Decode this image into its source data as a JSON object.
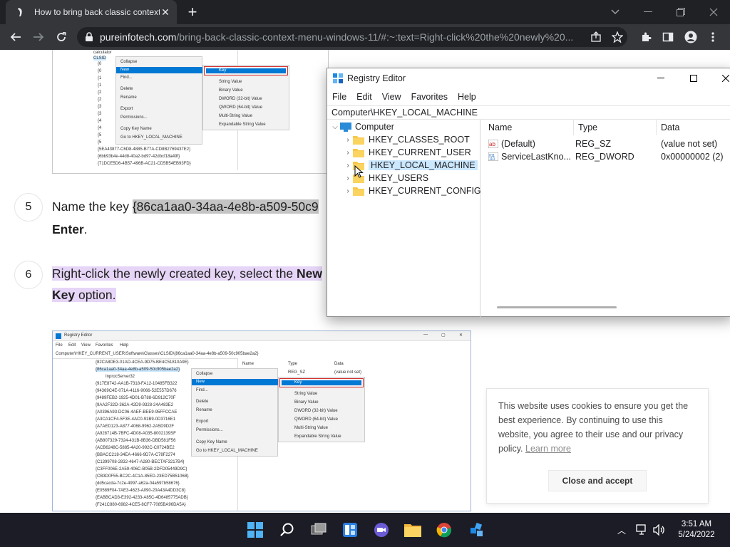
{
  "browser": {
    "tab_title": "How to bring back classic context menu",
    "url_host": "pureinfotech.com",
    "url_path": "/bring-back-classic-context-menu-windows-11/#:~:text=Right-click%20the%20newly%20..."
  },
  "screenshot1": {
    "tree": [
      "calculator",
      "CLSID",
      "{0",
      "{0",
      "{1",
      "{1",
      "{2",
      "{2",
      "{3",
      "{3",
      "{4",
      "{4",
      "{5",
      "{5",
      "{5EA43877-C6D8-4885-B77A-CD8B2769437E2}",
      "{6bb93b4e-44d8-40a2-bd97-42dbcf18a49f}",
      "{71DCE5D6-4B57-496B-AC21-CD5B54EB93FD}"
    ],
    "context_menu": [
      "Collapse",
      "New",
      "Find...",
      "Delete",
      "Rename",
      "Export",
      "Permissions...",
      "Copy Key Name",
      "Go to HKEY_LOCAL_MACHINE"
    ],
    "submenu": [
      "Key",
      "String Value",
      "Binary Value",
      "DWORD (32-bit) Value",
      "QWORD (64-bit) Value",
      "Multi-String Value",
      "Expandable String Value"
    ]
  },
  "steps": [
    {
      "num": "5",
      "pre": "Name the key ",
      "highlight": "{86ca1aa0-34aa-4e8b-a509-50c9",
      "line2_bold": "Enter",
      "line2_rest": "."
    },
    {
      "num": "6",
      "line1": "Right-click the newly created key, select the ",
      "line1_bold": "New",
      "line2_bold": "Key",
      "line2_rest": " option."
    }
  ],
  "screenshot2": {
    "title": "Registry Editor",
    "menu": [
      "File",
      "Edit",
      "View",
      "Favorites",
      "Help"
    ],
    "address": "Computer\\HKEY_CURRENT_USER\\Software\\Classes\\CLSID\\{86ca1aa0-34aa-4e8b-a509-50c905bae2a2}",
    "tree": [
      "{82CA8DE3-01AD-4CEA-9D75-BE4C51810A9E}",
      "{86ca1aa0-34aa-4e8b-a509-50c905bae2a2}",
      "InprocServer32",
      "{917E8742-AA1B-7318-FA12-10485FB322",
      "{94369C4E-071A-4116-9066-52E557D676",
      "{9489FEB2-1925-4D01-B788-6D912C70F",
      "{9AA2F32D-362A-42D9-9328-24A483E2",
      "{A0396A93-DC06-4AEF-BEE9-95FFCCAE",
      "{A3CA1CF4-5F3E-4AC0-91B9-0D3716E1",
      "{A7AED123-A877-4068-9962-2A5D9D2F",
      "{A928714B-7BFC-4D08-A035-8002139SF",
      "{AB807329-7324-431B-8B36-DBD581F56",
      "{ACB6248C-5885-4A20-992C-C0724BE2",
      "{BBACC218-34EA-4666-9D7A-C78F2274",
      "{C1399708-2832-4647-A280-BECTAF3217B4}",
      "{C3FF006E-2A59-406C-B05B-2DFD05449D9C}",
      "{CB3D0F55-BC2C-4C1A-85ED-23ED75B5106B}",
      "{dd5cacda-7c2e-4997-a62a-04a597b58676}",
      "{E0589F04-7AE3-4623-A090-20A43A4DD3C8}",
      "{EABBCAD3-E392-4233-A85C-4D6485775ADB}",
      "{F241C880-6982-4CE5-8CF7-7085BA96DA5A}"
    ],
    "list_headers": [
      "Name",
      "Type",
      "Data"
    ],
    "list_row": [
      "",
      "REG_SZ",
      "(value not set)"
    ],
    "context_menu": [
      "Collapse",
      "New",
      "Find...",
      "Delete",
      "Rename",
      "Export",
      "Permissions...",
      "Copy Key Name",
      "Go to HKEY_LOCAL_MACHINE"
    ],
    "submenu": [
      "Key",
      "String Value",
      "Binary Value",
      "DWORD (32-bit) Value",
      "QWORD (64-bit) Value",
      "Multi-String Value",
      "Expandable String Value"
    ]
  },
  "registry": {
    "title": "Registry Editor",
    "menu": [
      "File",
      "Edit",
      "View",
      "Favorites",
      "Help"
    ],
    "address": "Computer\\HKEY_LOCAL_MACHINE",
    "root": "Computer",
    "hives": [
      "HKEY_CLASSES_ROOT",
      "HKEY_CURRENT_USER",
      "HKEY_LOCAL_MACHINE",
      "HKEY_USERS",
      "HKEY_CURRENT_CONFIG"
    ],
    "columns": [
      "Name",
      "Type",
      "Data"
    ],
    "rows": [
      {
        "name": "(Default)",
        "type": "REG_SZ",
        "data": "(value not set)"
      },
      {
        "name": "ServiceLastKno...",
        "type": "REG_DWORD",
        "data": "0x00000002 (2)"
      }
    ]
  },
  "cookie": {
    "text": "This website uses cookies to ensure you get the best experience. By continuing to use this website, you agree to their use and our privacy policy.",
    "link": "Learn more",
    "button": "Close and accept"
  },
  "taskbar": {
    "time": "3:51 AM",
    "date": "5/24/2022"
  },
  "colors": {
    "chrome_dark": "#202124",
    "chrome_toolbar": "#35363a",
    "highlight_purple": "#e6d5f7",
    "highlight_gray": "#c4c4c4",
    "win_accent": "#0078d4",
    "menu_red": "#d32f2f"
  }
}
